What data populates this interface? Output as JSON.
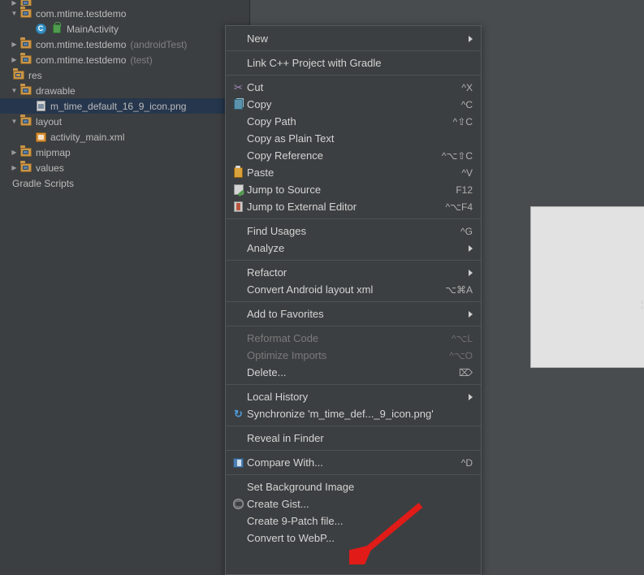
{
  "colors": {
    "menu_bg": "#3c3f41",
    "tree_bg": "#3c3f41",
    "canvas_bg": "#484c4f",
    "selection_bg": "#26364d",
    "text": "#d4d4d4",
    "disabled_text": "#7a7a7a",
    "shortcut_text": "#b0b0b0",
    "separator": "#4e5254",
    "annotation_arrow": "#e01b18",
    "preview_bg": "#e2e2e2"
  },
  "project_tree": {
    "rows": [
      {
        "indent": 1,
        "twisty": "collapsed-partial",
        "icon": "folder-icon",
        "label": "",
        "sublabel": "",
        "selected": false,
        "partial": true
      },
      {
        "indent": 1,
        "twisty": "expanded",
        "icon": "package-folder-icon",
        "label": "com.mtime.testdemo",
        "sublabel": "",
        "selected": false
      },
      {
        "indent": 3,
        "twisty": "none",
        "icon": "java-class-icon",
        "label": "MainActivity",
        "sublabel": "",
        "selected": false
      },
      {
        "indent": 1,
        "twisty": "collapsed",
        "icon": "package-folder-icon",
        "label": "com.mtime.testdemo",
        "sublabel": "(androidTest)",
        "selected": false
      },
      {
        "indent": 1,
        "twisty": "collapsed",
        "icon": "package-folder-icon",
        "label": "com.mtime.testdemo",
        "sublabel": "(test)",
        "selected": false
      },
      {
        "indent": 0,
        "twisty": "none",
        "icon": "res-folder-icon",
        "label": "res",
        "sublabel": "",
        "selected": false
      },
      {
        "indent": 1,
        "twisty": "expanded",
        "icon": "folder-icon",
        "label": "drawable",
        "sublabel": "",
        "selected": false
      },
      {
        "indent": 3,
        "twisty": "none",
        "icon": "png-file-icon",
        "label": "m_time_default_16_9_icon.png",
        "sublabel": "",
        "selected": true
      },
      {
        "indent": 1,
        "twisty": "expanded",
        "icon": "folder-icon",
        "label": "layout",
        "sublabel": "",
        "selected": false
      },
      {
        "indent": 3,
        "twisty": "none",
        "icon": "xml-layout-icon",
        "label": "activity_main.xml",
        "sublabel": "",
        "selected": false
      },
      {
        "indent": 1,
        "twisty": "collapsed",
        "icon": "folder-icon",
        "label": "mipmap",
        "sublabel": "",
        "selected": false
      },
      {
        "indent": 1,
        "twisty": "collapsed",
        "icon": "folder-icon",
        "label": "values",
        "sublabel": "",
        "selected": false
      },
      {
        "indent": 0,
        "twisty": "none",
        "icon": "none",
        "label": "Gradle Scripts",
        "sublabel": "",
        "selected": false
      }
    ]
  },
  "context_menu": {
    "groups": [
      {
        "items": [
          {
            "label": "New",
            "shortcut": "",
            "icon": "none",
            "submenu": true,
            "disabled": false
          }
        ]
      },
      {
        "items": [
          {
            "label": "Link C++ Project with Gradle",
            "shortcut": "",
            "icon": "none",
            "submenu": false,
            "disabled": false
          }
        ]
      },
      {
        "items": [
          {
            "label": "Cut",
            "shortcut": "^X",
            "icon": "scissors-icon",
            "submenu": false,
            "disabled": false
          },
          {
            "label": "Copy",
            "shortcut": "^C",
            "icon": "copy-icon",
            "submenu": false,
            "disabled": false
          },
          {
            "label": "Copy Path",
            "shortcut": "^⇧C",
            "icon": "none",
            "submenu": false,
            "disabled": false
          },
          {
            "label": "Copy as Plain Text",
            "shortcut": "",
            "icon": "none",
            "submenu": false,
            "disabled": false
          },
          {
            "label": "Copy Reference",
            "shortcut": "^⌥⇧C",
            "icon": "none",
            "submenu": false,
            "disabled": false
          },
          {
            "label": "Paste",
            "shortcut": "^V",
            "icon": "paste-icon",
            "submenu": false,
            "disabled": false
          },
          {
            "label": "Jump to Source",
            "shortcut": "F12",
            "icon": "jump-to-source-icon",
            "submenu": false,
            "disabled": false
          },
          {
            "label": "Jump to External Editor",
            "shortcut": "^⌥F4",
            "icon": "external-editor-icon",
            "submenu": false,
            "disabled": false
          }
        ]
      },
      {
        "items": [
          {
            "label": "Find Usages",
            "shortcut": "^G",
            "icon": "none",
            "submenu": false,
            "disabled": false
          },
          {
            "label": "Analyze",
            "shortcut": "",
            "icon": "none",
            "submenu": true,
            "disabled": false
          }
        ]
      },
      {
        "items": [
          {
            "label": "Refactor",
            "shortcut": "",
            "icon": "none",
            "submenu": true,
            "disabled": false
          },
          {
            "label": "Convert Android layout xml",
            "shortcut": "⌥⌘A",
            "icon": "none",
            "submenu": false,
            "disabled": false
          }
        ]
      },
      {
        "items": [
          {
            "label": "Add to Favorites",
            "shortcut": "",
            "icon": "none",
            "submenu": true,
            "disabled": false
          }
        ]
      },
      {
        "items": [
          {
            "label": "Reformat Code",
            "shortcut": "^⌥L",
            "icon": "none",
            "submenu": false,
            "disabled": true
          },
          {
            "label": "Optimize Imports",
            "shortcut": "^⌥O",
            "icon": "none",
            "submenu": false,
            "disabled": true
          },
          {
            "label": "Delete...",
            "shortcut": "⌦",
            "icon": "none",
            "submenu": false,
            "disabled": false
          }
        ]
      },
      {
        "items": [
          {
            "label": "Local History",
            "shortcut": "",
            "icon": "none",
            "submenu": true,
            "disabled": false
          },
          {
            "label": "Synchronize 'm_time_def..._9_icon.png'",
            "shortcut": "",
            "icon": "sync-icon",
            "submenu": false,
            "disabled": false
          }
        ]
      },
      {
        "items": [
          {
            "label": "Reveal in Finder",
            "shortcut": "",
            "icon": "none",
            "submenu": false,
            "disabled": false
          }
        ]
      },
      {
        "items": [
          {
            "label": "Compare With...",
            "shortcut": "^D",
            "icon": "compare-icon",
            "submenu": false,
            "disabled": false
          }
        ]
      },
      {
        "items": [
          {
            "label": "Set Background Image",
            "shortcut": "",
            "icon": "none",
            "submenu": false,
            "disabled": false
          },
          {
            "label": "Create Gist...",
            "shortcut": "",
            "icon": "gist-icon",
            "submenu": false,
            "disabled": false
          },
          {
            "label": "Create 9-Patch file...",
            "shortcut": "",
            "icon": "none",
            "submenu": false,
            "disabled": false
          },
          {
            "label": "Convert to WebP...",
            "shortcut": "",
            "icon": "none",
            "submenu": false,
            "disabled": false
          }
        ]
      }
    ]
  },
  "preview": {
    "faint_text_line1": "S",
    "faint_text_line2": "p"
  },
  "annotation": {
    "arrow_color": "#e01b18",
    "points_to": "Create 9-Patch file..."
  }
}
